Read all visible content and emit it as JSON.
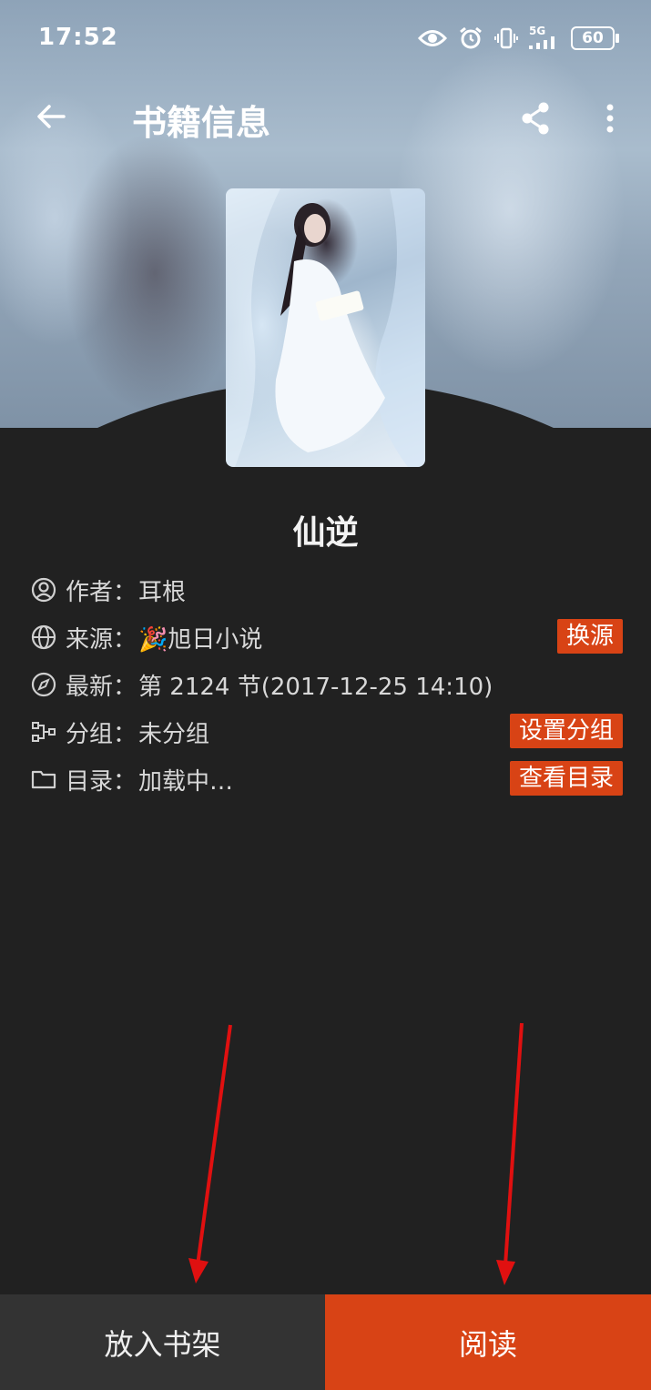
{
  "status_bar": {
    "time": "17:52",
    "network": "5G",
    "battery": "60"
  },
  "top_bar": {
    "title": "书籍信息"
  },
  "book": {
    "title": "仙逆"
  },
  "info": {
    "author": {
      "label": "作者：",
      "value": "耳根"
    },
    "source": {
      "label": "来源：",
      "value": "🎉旭日小说",
      "action": "换源"
    },
    "latest": {
      "label": "最新：",
      "value": "第 2124 节(2017-12-25 14:10)"
    },
    "group": {
      "label": "分组：",
      "value": "未分组",
      "action": "设置分组"
    },
    "toc": {
      "label": "目录：",
      "value": "加载中…",
      "action": "查看目录"
    }
  },
  "bottom_bar": {
    "add_to_shelf": "放入书架",
    "read": "阅读"
  },
  "colors": {
    "accent": "#d84315",
    "background": "#212121",
    "annotation_arrow": "#e01010"
  }
}
